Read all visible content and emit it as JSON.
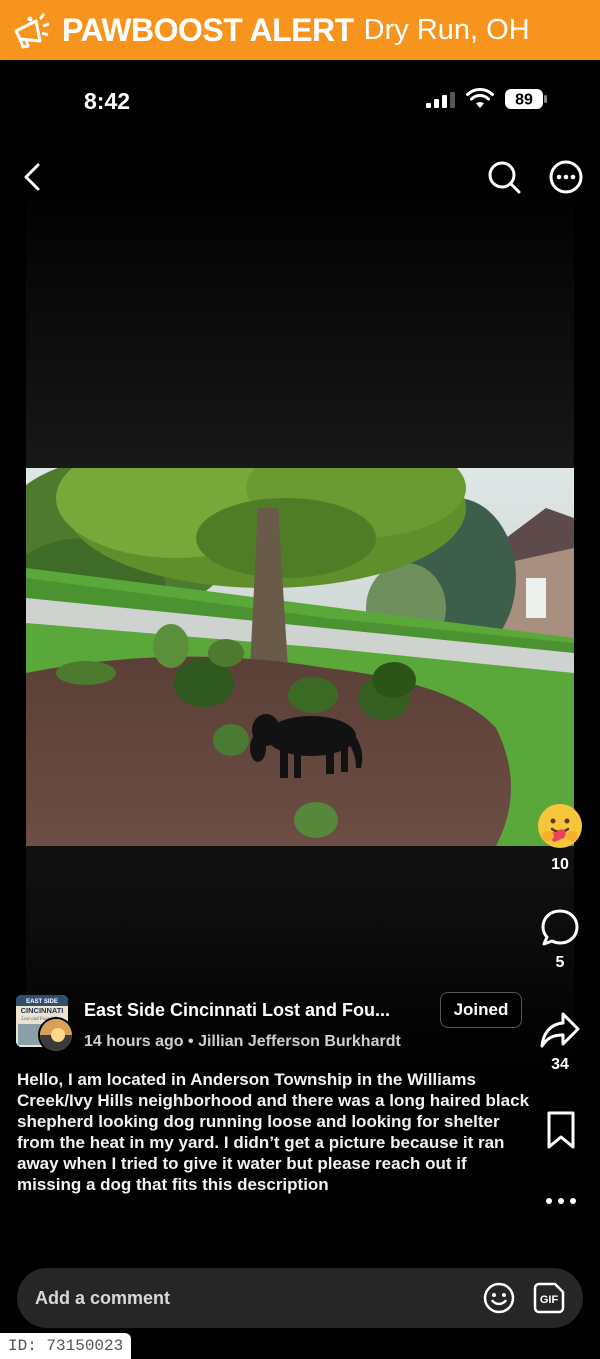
{
  "alert": {
    "brand": "PAWBOOST ALERT",
    "location": "Dry Run, OH",
    "color": "#f7941d"
  },
  "status_bar": {
    "time": "8:42",
    "battery": "89"
  },
  "topbar": {
    "back_icon": "chevron-left-icon",
    "search_icon": "search-icon",
    "more_icon": "more-horizontal-icon"
  },
  "actions": {
    "reactions_count": "10",
    "comments_count": "5",
    "shares_count": "34"
  },
  "post": {
    "group_name": "East Side Cincinnati Lost and Fou...",
    "joined_label": "Joined",
    "meta": "14 hours ago • Jillian Jefferson Burkhardt",
    "text": "Hello, I am located in Anderson Township in the Williams Creek/Ivy Hills neighborhood  and there was a long haired black shepherd looking dog running loose and looking for shelter from the heat in my yard. I didn’t get a picture because it ran away when I tried to give it water but please reach out if missing a dog that fits this description",
    "page_avatar_text": "EAST SIDE CINCINNATI Lost and Found Pets"
  },
  "comment": {
    "placeholder": "Add a comment",
    "gif_label": "GIF"
  },
  "footer": {
    "id": "ID: 73150023"
  }
}
